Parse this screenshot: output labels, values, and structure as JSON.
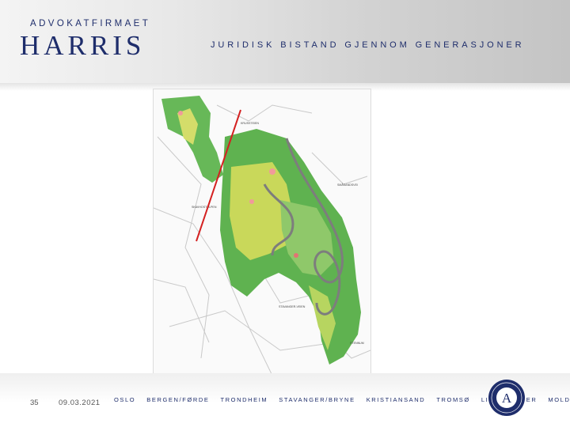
{
  "header": {
    "firm_small": "ADVOKATFIRMAET",
    "firm_name": "HARRIS",
    "tagline": "JURIDISK BISTAND GJENNOM GENERASJONER"
  },
  "map": {
    "labels": [
      "KRUSSTEIEN",
      "SMÅSANDSVEI",
      "STAVANGER-VEIEN",
      "STENNUM",
      "SKAVHOSTOLPEN"
    ]
  },
  "footer": {
    "page_number": "35",
    "date": "09.03.2021",
    "cities": [
      "OSLO",
      "BERGEN/FØRDE",
      "TRONDHEIM",
      "STAVANGER/BRYNE",
      "KRISTIANSAND",
      "TROMSØ",
      "LILLEHAMMER",
      "MOLDE"
    ],
    "seal_letter": "A"
  },
  "colors": {
    "brand": "#1e2d6b",
    "marker_line": "#d42020",
    "terrain_green": "#56b04a"
  }
}
